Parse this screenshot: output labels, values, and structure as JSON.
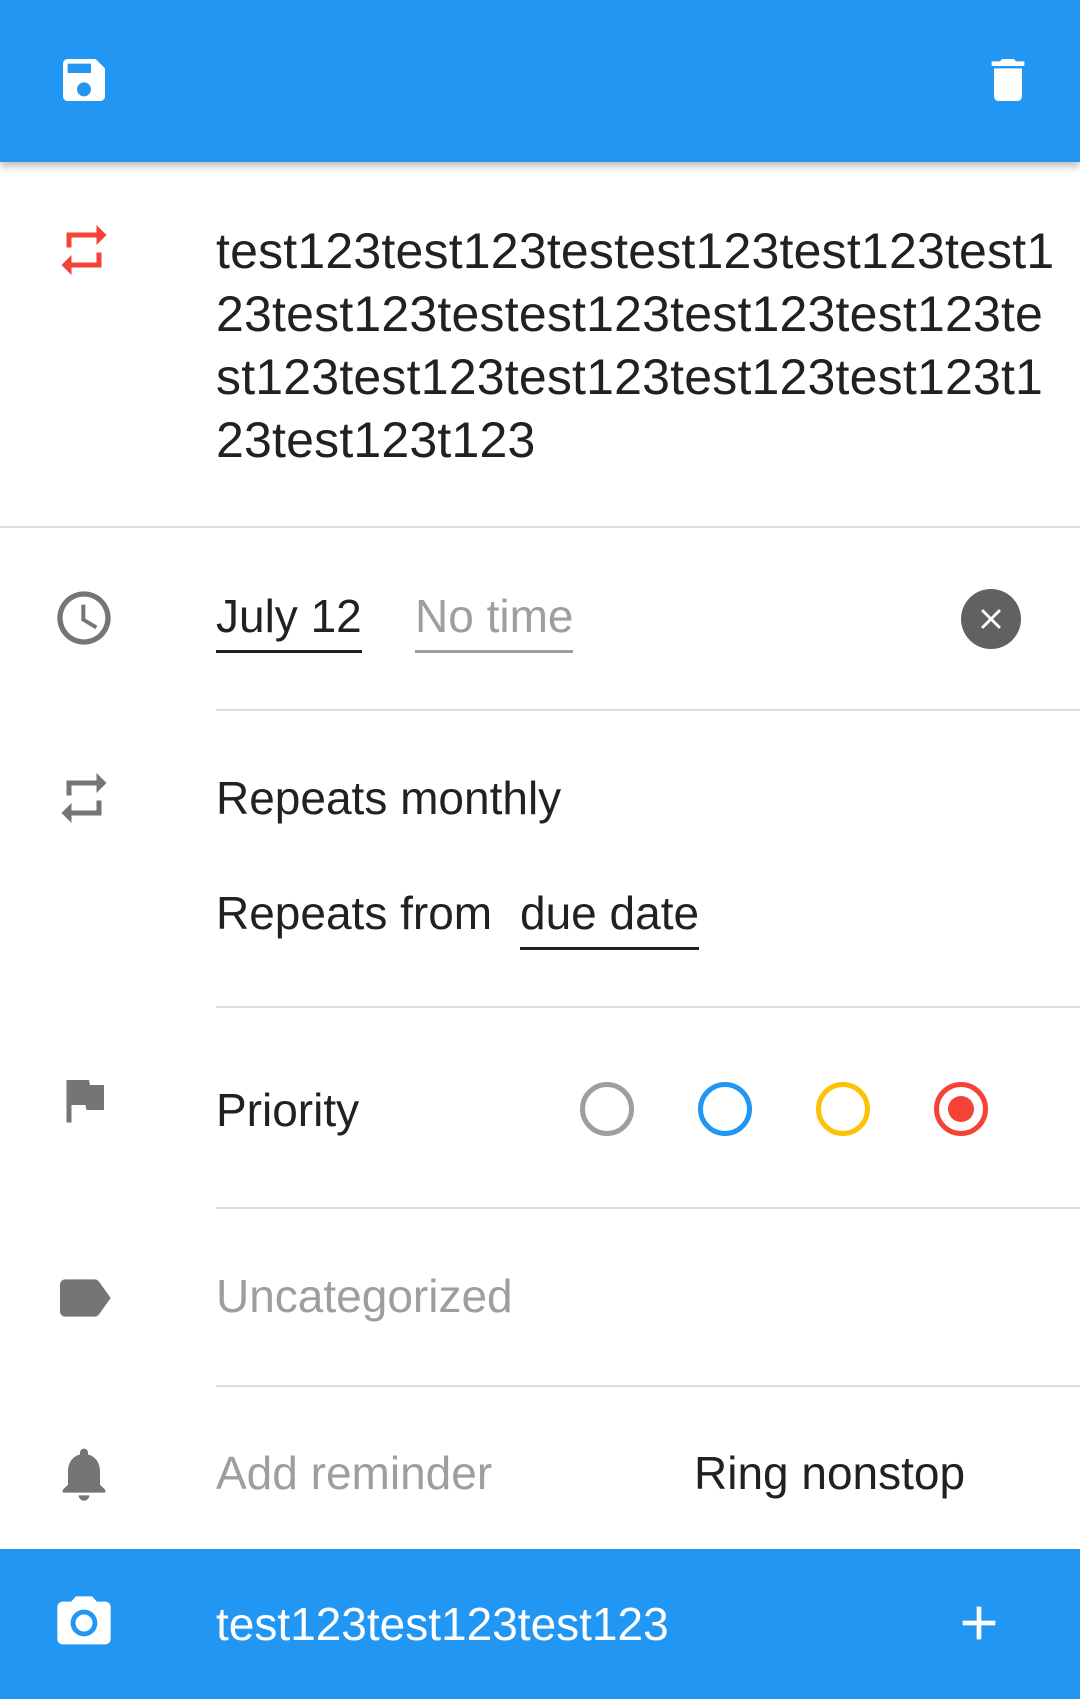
{
  "toolbar": {
    "save_icon": "save-icon",
    "delete_icon": "delete-icon",
    "background": "#2196F3"
  },
  "task": {
    "title": "test123test123testest123test123test123test123testest123test123test123test123test123test123test123test123t123test123t123",
    "title_icon": "repeat-icon",
    "title_icon_color": "#F44336"
  },
  "due": {
    "date": "July 12",
    "time_placeholder": "No time",
    "clock_icon": "clock-icon",
    "clear_icon": "clear-icon"
  },
  "repeat": {
    "label": "Repeats monthly",
    "from_prefix": "Repeats from",
    "from_value": "due date",
    "icon": "repeat-icon"
  },
  "priority": {
    "label": "Priority",
    "icon": "flag-icon",
    "options": [
      {
        "color": "#9e9e9e",
        "selected": false
      },
      {
        "color": "#2196F3",
        "selected": false
      },
      {
        "color": "#FFC107",
        "selected": false
      },
      {
        "color": "#F44336",
        "selected": true
      }
    ]
  },
  "category": {
    "placeholder": "Uncategorized",
    "icon": "label-icon"
  },
  "reminder": {
    "placeholder": "Add reminder",
    "mode": "Ring nonstop",
    "icon": "bell-icon"
  },
  "attachment": {
    "text": "test123test123test123",
    "camera_icon": "camera-icon",
    "add_icon": "plus-icon"
  }
}
